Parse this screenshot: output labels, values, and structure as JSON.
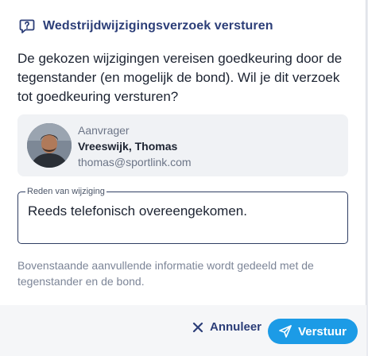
{
  "dialog": {
    "title": "Wedstrijdwijzigingsverzoek versturen",
    "title_icon": "question-bubble-icon",
    "message": "De gekozen wijzigingen vereisen goedkeuring door de tegenstander (en mogelijk de bond). Wil je dit verzoek tot goedkeuring versturen?"
  },
  "requester": {
    "role": "Aanvrager",
    "name": "Vreeswijk, Thomas",
    "email": "thomas@sportlink.com"
  },
  "reason_field": {
    "label": "Reden van wijziging",
    "value": "Reeds telefonisch overeengekomen."
  },
  "info_text": "Bovenstaande aanvullende informatie wordt gedeeld met de tegenstander en de bond.",
  "actions": {
    "cancel_label": "Annuleer",
    "cancel_icon": "close-icon",
    "submit_label": "Verstuur",
    "submit_icon": "paper-plane-icon"
  },
  "colors": {
    "accent": "#1c9be6",
    "title": "#2c3e78"
  }
}
